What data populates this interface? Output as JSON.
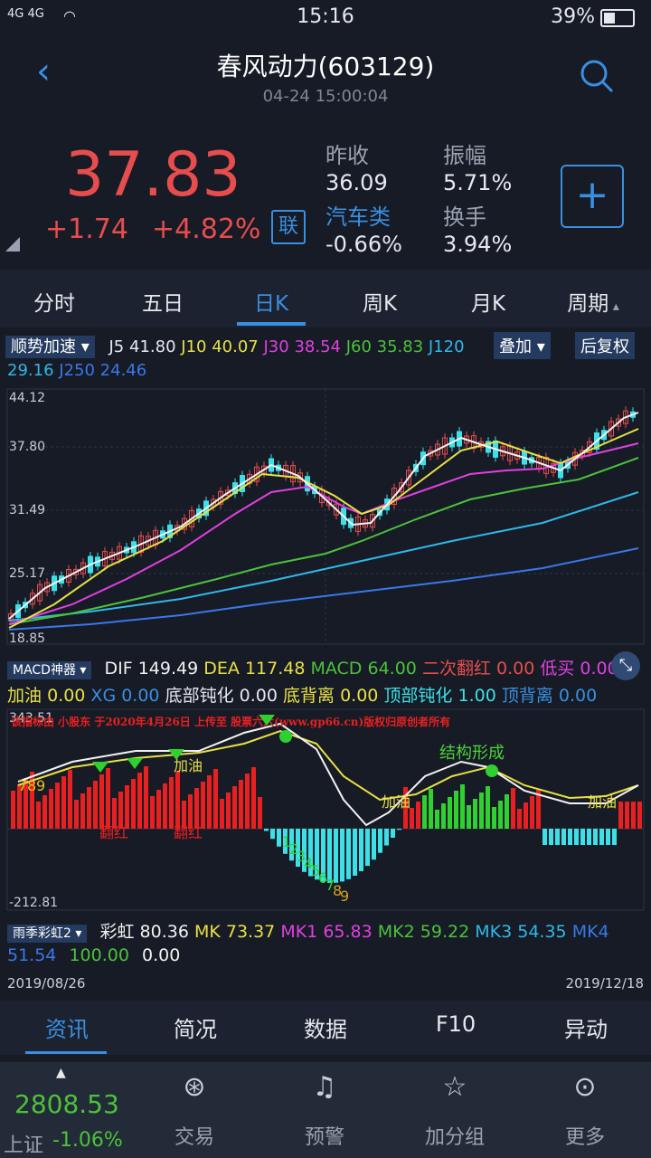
{
  "status": {
    "signal": "4G 4G",
    "time": "15:16",
    "battery": "39%"
  },
  "header": {
    "title": "春风动力(603129)",
    "subtitle": "04-24 15:00:04"
  },
  "quote": {
    "price": "37.83",
    "change": "+1.74",
    "change_pct": "+4.82%",
    "lian": "联",
    "prev_close_label": "昨收",
    "prev_close": "36.09",
    "amplitude_label": "振幅",
    "amplitude": "5.71%",
    "sector_label": "汽车类",
    "sector_change": "-0.66%",
    "turnover_label": "换手",
    "turnover": "3.94%",
    "add_button": "+"
  },
  "tabs": [
    "分时",
    "五日",
    "日K",
    "周K",
    "月K",
    "周期"
  ],
  "active_tab": "日K",
  "ma_row": {
    "indicator": "顺势加速",
    "j5_label": "J5",
    "j5": "41.80",
    "j10_label": "J10",
    "j10": "40.07",
    "j30_label": "J30",
    "j30": "38.54",
    "j60_label": "J60",
    "j60": "35.83",
    "j120_label": "J120",
    "j120_val": "29.16",
    "j250_label": "J250",
    "j250": "24.46",
    "overlay": "叠加",
    "restore": "后复权"
  },
  "kline": {
    "y_labels": [
      "44.12",
      "37.80",
      "31.49",
      "25.17",
      "18.85"
    ]
  },
  "macd_row": {
    "indicator": "MACD神器",
    "dif_label": "DIF",
    "dif": "149.49",
    "dea_label": "DEA",
    "dea": "117.48",
    "macd_label": "MACD",
    "macd": "64.00",
    "second_red_label": "二次翻红",
    "second_red": "0.00",
    "low_buy_label": "低买",
    "low_buy": "0.00",
    "add_oil_label": "加油",
    "add_oil": "0.00",
    "xg_label": "XG",
    "xg": "0.00",
    "bottom_dull_label": "底部钝化",
    "bottom_dull": "0.00",
    "bottom_div_label": "底背离",
    "bottom_div": "0.00",
    "top_dull_label": "顶部钝化",
    "top_dull": "1.00",
    "top_div_label": "顶背离",
    "top_div": "0.00"
  },
  "macd_chart": {
    "y_top": "343.51",
    "y_bottom": "-212.81",
    "watermark": "该指标由 小股东 于2020年4月26日 上传至 股票六六(www.gp66.cn)版权归原创者所有",
    "annotations": [
      "加油",
      "结构形成",
      "加油",
      "加油",
      "翻红",
      "翻红"
    ],
    "digits": [
      "7",
      "8",
      "9",
      "1",
      "2",
      "3",
      "4",
      "5",
      "6",
      "7",
      "8",
      "9"
    ]
  },
  "rainbow_row": {
    "indicator": "雨季彩虹2",
    "rainbow_label": "彩虹",
    "rainbow": "80.36",
    "mk_label": "MK",
    "mk": "73.37",
    "mk1_label": "MK1",
    "mk1": "65.83",
    "mk2_label": "MK2",
    "mk2": "59.22",
    "mk3_label": "MK3",
    "mk3": "54.35",
    "mk4_label": "MK4",
    "mk4": "51.54",
    "v1": "100.00",
    "v2": "0.00"
  },
  "dates": {
    "start": "2019/08/26",
    "end": "2019/12/18"
  },
  "bottom_tabs": [
    "资讯",
    "简况",
    "数据",
    "F10",
    "异动"
  ],
  "index": {
    "value": "2808.53",
    "name": "上证",
    "change": "-1.06%"
  },
  "nav": [
    "交易",
    "预警",
    "加分组",
    "更多"
  ],
  "colors": {
    "up": "#e84d4d",
    "down": "#3ee0e8",
    "accent": "#3a8fe0"
  }
}
